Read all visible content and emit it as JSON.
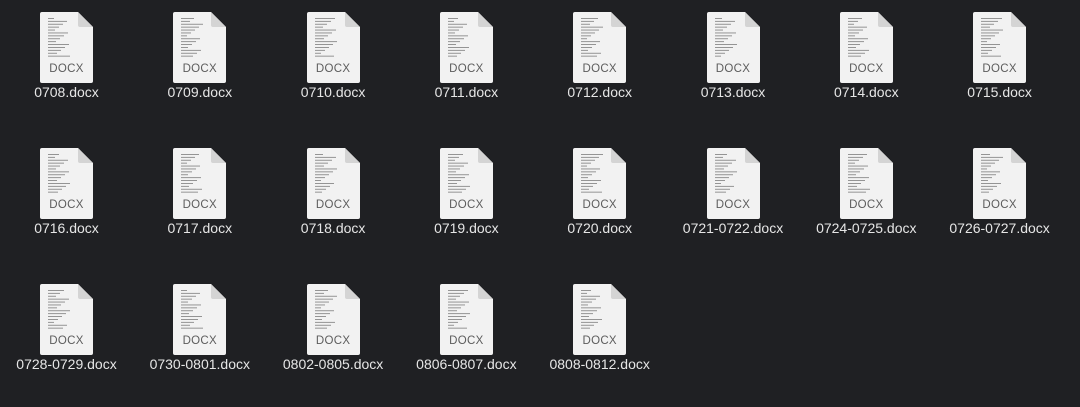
{
  "window": {
    "background": "#1f2023"
  },
  "icon": {
    "type_label": "DOCX",
    "page_color": "#f2f2f2",
    "fold_color": "#d4d4d4",
    "line_color": "#8a8a8a"
  },
  "files": [
    {
      "name": "0708.docx"
    },
    {
      "name": "0709.docx"
    },
    {
      "name": "0710.docx"
    },
    {
      "name": "0711.docx"
    },
    {
      "name": "0712.docx"
    },
    {
      "name": "0713.docx"
    },
    {
      "name": "0714.docx"
    },
    {
      "name": "0715.docx"
    },
    {
      "name": "0716.docx"
    },
    {
      "name": "0717.docx"
    },
    {
      "name": "0718.docx"
    },
    {
      "name": "0719.docx"
    },
    {
      "name": "0720.docx"
    },
    {
      "name": "0721-0722.docx"
    },
    {
      "name": "0724-0725.docx"
    },
    {
      "name": "0726-0727.docx"
    },
    {
      "name": "0728-0729.docx"
    },
    {
      "name": "0730-0801.docx"
    },
    {
      "name": "0802-0805.docx"
    },
    {
      "name": "0806-0807.docx"
    },
    {
      "name": "0808-0812.docx"
    }
  ]
}
